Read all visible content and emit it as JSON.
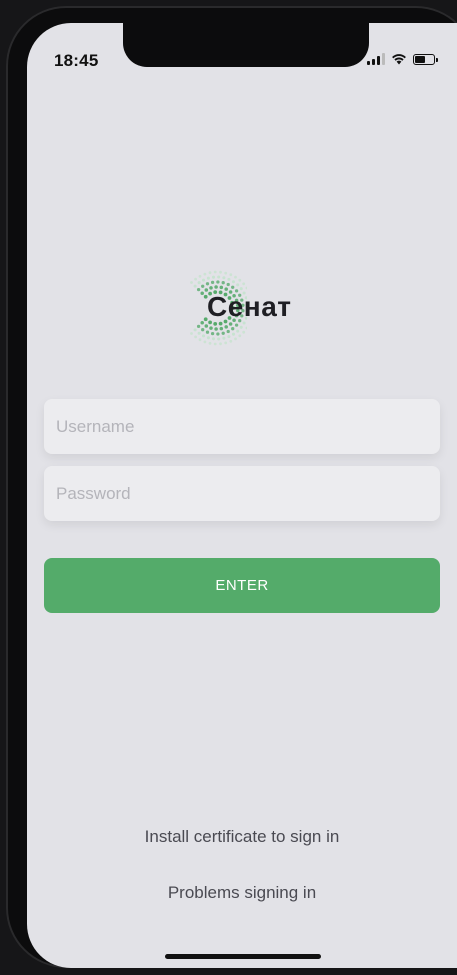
{
  "status_bar": {
    "time": "18:45",
    "signal_icon": "cellular-signal-icon",
    "wifi_icon": "wifi-icon",
    "battery_icon": "battery-icon",
    "battery_level": 0.6
  },
  "logo": {
    "text": "Сенат",
    "icon": "dotted-c-logo-icon",
    "colors": {
      "text": "#1f1f24",
      "dots_light": "#b9e3c3",
      "dots_dark": "#4fa765"
    }
  },
  "form": {
    "username_placeholder": "Username",
    "password_placeholder": "Password",
    "username_value": "",
    "password_value": "",
    "enter_label": "ENTER"
  },
  "links": {
    "install_certificate": "Install certificate to sign in",
    "problems_signing_in": "Problems signing in"
  },
  "colors": {
    "background": "#e2e2e7",
    "accent": "#54ab6a",
    "field_background": "#ececef",
    "placeholder": "#b4b4ba",
    "link_text": "#4a4a52"
  }
}
